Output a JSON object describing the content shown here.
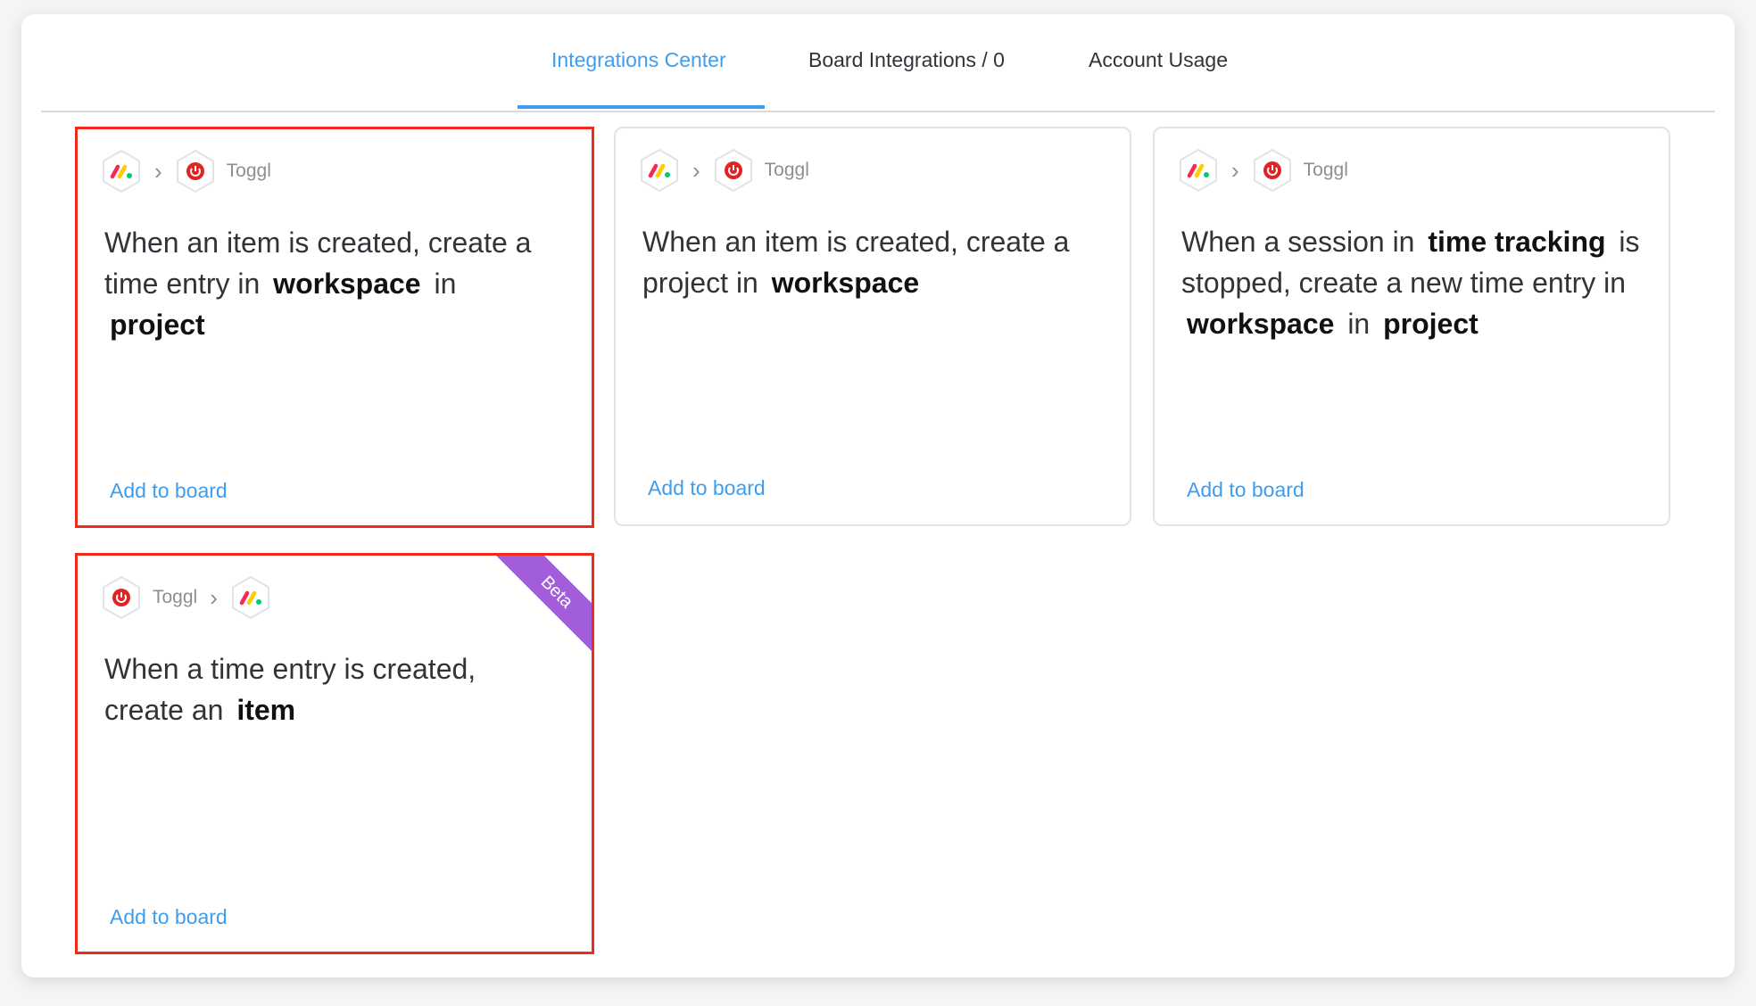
{
  "tabs": [
    {
      "label": "Integrations Center",
      "active": true
    },
    {
      "label": "Board Integrations / 0",
      "active": false
    },
    {
      "label": "Account Usage",
      "active": false
    }
  ],
  "colors": {
    "accent": "#3f9ded",
    "selection": "#ee2c1a",
    "beta": "#a25ddc",
    "toggl": "#e02424"
  },
  "cards": [
    {
      "header": {
        "first_icon": "monday-logo-icon",
        "second_icon": "toggl-icon",
        "app": "Toggl"
      },
      "recipe": {
        "t1": "When an item is created, create a time entry in",
        "b1": "workspace",
        "t2": "in",
        "b2": "project"
      },
      "action": "Add to board",
      "selected": true
    },
    {
      "header": {
        "first_icon": "monday-logo-icon",
        "second_icon": "toggl-icon",
        "app": "Toggl"
      },
      "recipe": {
        "t1": "When an item is created, create a project in",
        "b1": "workspace"
      },
      "action": "Add to board",
      "selected": false
    },
    {
      "header": {
        "first_icon": "monday-logo-icon",
        "second_icon": "toggl-icon",
        "app": "Toggl"
      },
      "recipe": {
        "t1": "When a session in",
        "b1": "time tracking",
        "t2": "is stopped, create a new time entry in",
        "b2": "workspace",
        "t3": "in",
        "b3": "project"
      },
      "action": "Add to board",
      "selected": false
    },
    {
      "header": {
        "first_icon": "toggl-icon",
        "app": "Toggl",
        "second_icon": "monday-logo-icon"
      },
      "recipe": {
        "t1": "When a time entry is created, create an",
        "b1": "item"
      },
      "action": "Add to board",
      "badge": "Beta",
      "selected": true
    }
  ]
}
